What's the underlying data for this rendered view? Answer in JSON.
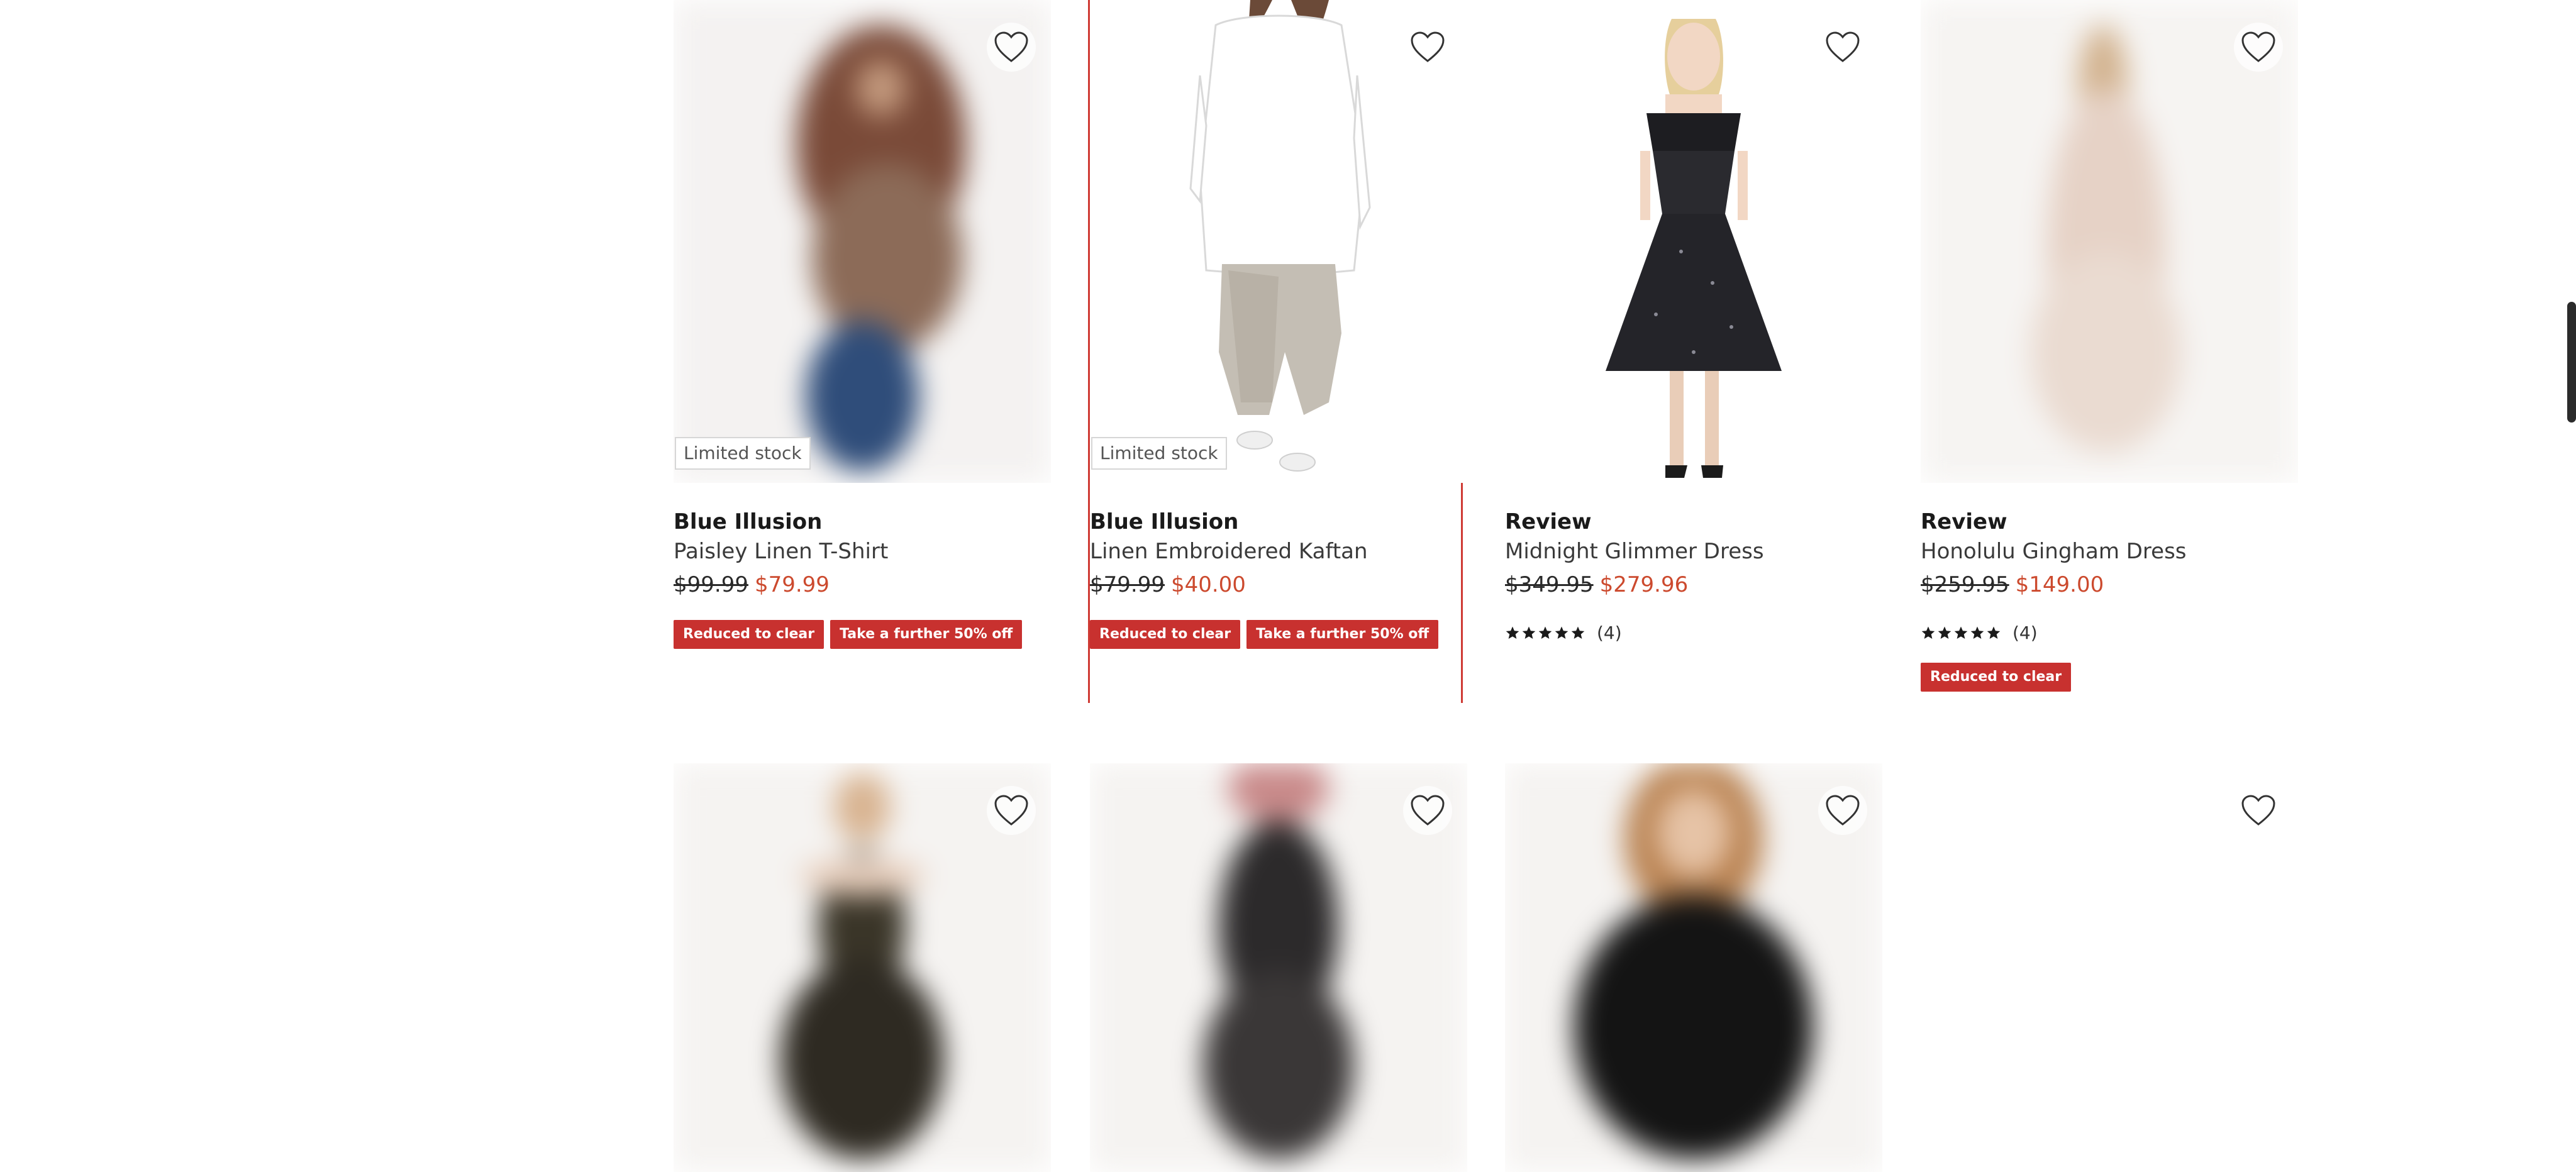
{
  "products": [
    {
      "brand": "Blue Illusion",
      "name": "Paisley Linen T-Shirt",
      "was": "$99.99",
      "now": "$79.99",
      "stock": "Limited stock",
      "badges": [
        "Reduced to clear",
        "Take a further 50% off"
      ]
    },
    {
      "brand": "Blue Illusion",
      "name": "Linen Embroidered Kaftan",
      "was": "$79.99",
      "now": "$40.00",
      "stock": "Limited stock",
      "badges": [
        "Reduced to clear",
        "Take a further 50% off"
      ]
    },
    {
      "brand": "Review",
      "name": "Midnight Glimmer Dress",
      "was": "$349.95",
      "now": "$279.96",
      "rating_count": "(4)",
      "rating_value": 5,
      "badges": []
    },
    {
      "brand": "Review",
      "name": "Honolulu Gingham Dress",
      "was": "$259.95",
      "now": "$149.00",
      "rating_count": "(4)",
      "rating_value": 5,
      "badges": [
        "Reduced to clear"
      ]
    }
  ],
  "icons": {
    "wishlist": "heart-outline-icon",
    "star": "star-icon"
  },
  "colors": {
    "sale_price": "#cc4a2e",
    "badge_bg": "#c8312f",
    "hover_outline": "#cf3a34"
  }
}
